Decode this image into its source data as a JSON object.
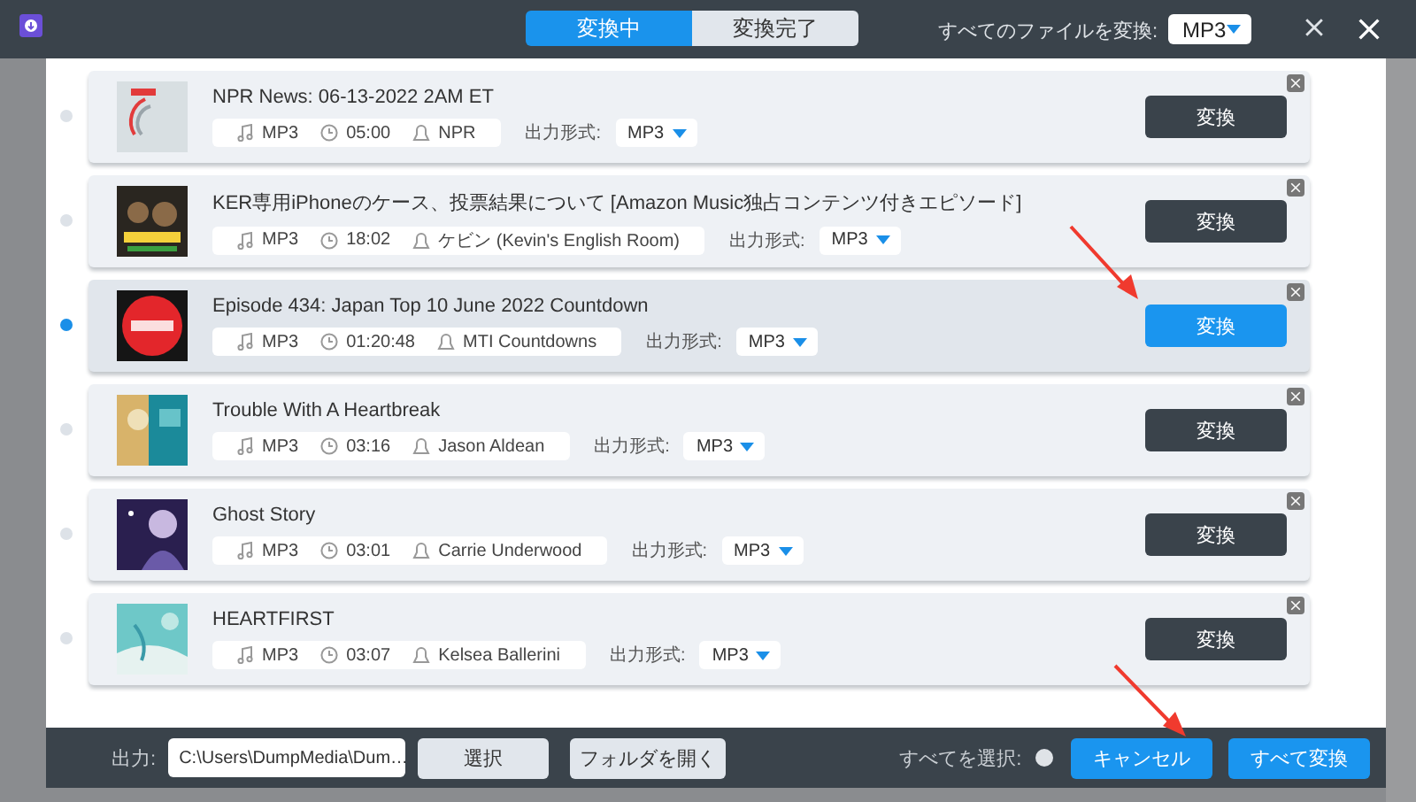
{
  "tabs": [
    {
      "label": "変換中",
      "selected": true
    },
    {
      "label": "変換完了",
      "selected": false
    }
  ],
  "convert_all_label": "すべてのファイルを変換:",
  "convert_all_format": "MP3",
  "items": [
    {
      "title": "NPR News: 06-13-2022 2AM ET",
      "format": "MP3",
      "duration": "05:00",
      "artist": "NPR",
      "output_label": "出力形式:",
      "output_format": "MP3",
      "button": "変換",
      "selected": false
    },
    {
      "title": "KER専用iPhoneのケース、投票結果について [Amazon Music独占コンテンツ付きエピソード]",
      "format": "MP3",
      "duration": "18:02",
      "artist": "ケビン (Kevin's English Room)",
      "output_label": "出力形式:",
      "output_format": "MP3",
      "button": "変換",
      "selected": false
    },
    {
      "title": "Episode 434: Japan Top 10 June 2022 Countdown",
      "format": "MP3",
      "duration": "01:20:48",
      "artist": "MTI Countdowns",
      "output_label": "出力形式:",
      "output_format": "MP3",
      "button": "変換",
      "selected": true
    },
    {
      "title": "Trouble With A Heartbreak",
      "format": "MP3",
      "duration": "03:16",
      "artist": "Jason Aldean",
      "output_label": "出力形式:",
      "output_format": "MP3",
      "button": "変換",
      "selected": false
    },
    {
      "title": "Ghost Story",
      "format": "MP3",
      "duration": "03:01",
      "artist": "Carrie Underwood",
      "output_label": "出力形式:",
      "output_format": "MP3",
      "button": "変換",
      "selected": false
    },
    {
      "title": "HEARTFIRST",
      "format": "MP3",
      "duration": "03:07",
      "artist": "Kelsea Ballerini",
      "output_label": "出力形式:",
      "output_format": "MP3",
      "button": "変換",
      "selected": false
    }
  ],
  "footer": {
    "output_label": "出力:",
    "output_path": "C:\\Users\\DumpMedia\\Dum…",
    "choose_button": "選択",
    "open_folder_button": "フォルダを開く",
    "select_all_label": "すべてを選択:",
    "select_all_checked": false,
    "cancel_button": "キャンセル",
    "convert_all_button": "すべて変換"
  }
}
